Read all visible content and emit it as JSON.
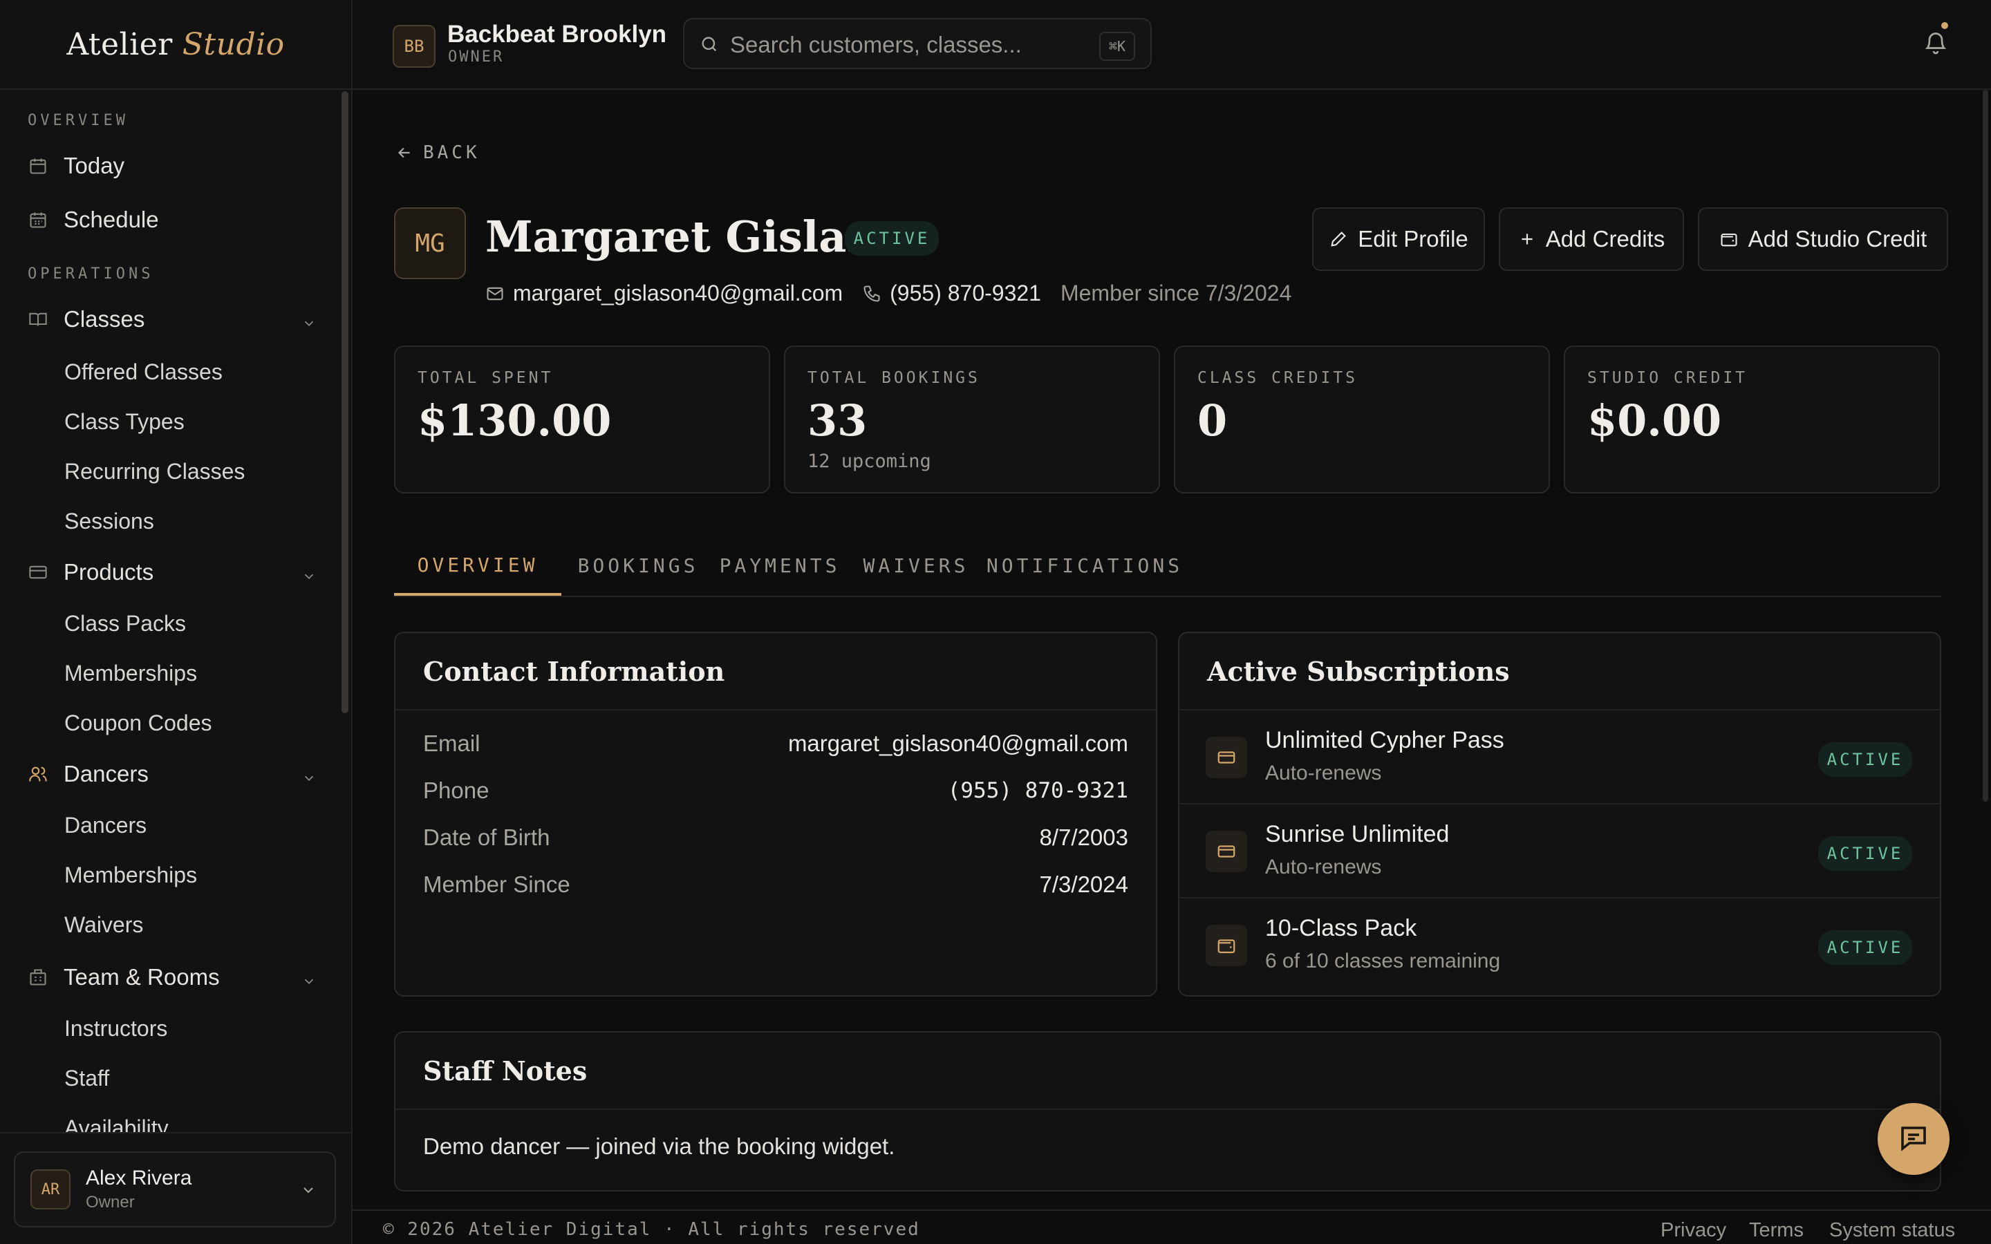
{
  "brand": {
    "part1": "Atelier",
    "part2": "Studio"
  },
  "sidebar": {
    "sections": [
      {
        "label": "OVERVIEW"
      },
      {
        "label": "OPERATIONS"
      }
    ],
    "items": [
      {
        "label": "Today",
        "icon": "calendar-icon"
      },
      {
        "label": "Schedule",
        "icon": "calendar-grid-icon"
      },
      {
        "label": "Classes",
        "icon": "book-icon"
      },
      {
        "label": "Products",
        "icon": "card-icon"
      },
      {
        "label": "Dancers",
        "icon": "users-icon"
      },
      {
        "label": "Team & Rooms",
        "icon": "building-icon"
      }
    ],
    "classes_sub": [
      "Offered Classes",
      "Class Types",
      "Recurring Classes",
      "Sessions"
    ],
    "products_sub": [
      "Class Packs",
      "Memberships",
      "Coupon Codes"
    ],
    "dancers_sub": [
      "Dancers",
      "Memberships",
      "Waivers"
    ],
    "team_sub": [
      "Instructors",
      "Staff",
      "Availability"
    ],
    "user": {
      "initials": "AR",
      "name": "Alex Rivera",
      "role": "Owner"
    }
  },
  "header": {
    "studio_initials": "BB",
    "studio_name": "Backbeat Brooklyn",
    "studio_role": "OWNER",
    "search_placeholder": "Search customers, classes...",
    "search_shortcut": "⌘K"
  },
  "customer": {
    "back_label": "BACK",
    "initials": "MG",
    "name": "Margaret Gislason",
    "status": "ACTIVE",
    "email": "margaret_gislason40@gmail.com",
    "phone": "(955) 870-9321",
    "member_since_text": "Member since 7/3/2024"
  },
  "actions": {
    "edit": "Edit Profile",
    "add_credits": "Add Credits",
    "add_studio_credit": "Add Studio Credit"
  },
  "stats": [
    {
      "label": "TOTAL SPENT",
      "value": "$130.00",
      "sub": ""
    },
    {
      "label": "TOTAL BOOKINGS",
      "value": "33",
      "sub": "12 upcoming"
    },
    {
      "label": "CLASS CREDITS",
      "value": "0",
      "sub": ""
    },
    {
      "label": "STUDIO CREDIT",
      "value": "$0.00",
      "sub": ""
    }
  ],
  "tabs": [
    {
      "label": "OVERVIEW",
      "active": true
    },
    {
      "label": "BOOKINGS"
    },
    {
      "label": "PAYMENTS"
    },
    {
      "label": "WAIVERS"
    },
    {
      "label": "NOTIFICATIONS"
    }
  ],
  "contact_card": {
    "title": "Contact Information",
    "rows": [
      {
        "key": "Email",
        "value": "margaret_gislason40@gmail.com"
      },
      {
        "key": "Phone",
        "value": "(955) 870-9321"
      },
      {
        "key": "Date of Birth",
        "value": "8/7/2003"
      },
      {
        "key": "Member Since",
        "value": "7/3/2024"
      }
    ]
  },
  "subscriptions_card": {
    "title": "Active Subscriptions",
    "items": [
      {
        "name": "Unlimited Cypher Pass",
        "desc": "Auto-renews",
        "status": "ACTIVE",
        "icon": "card-icon"
      },
      {
        "name": "Sunrise Unlimited",
        "desc": "Auto-renews",
        "status": "ACTIVE",
        "icon": "card-icon"
      },
      {
        "name": "10-Class Pack",
        "desc": "6 of 10 classes remaining",
        "status": "ACTIVE",
        "icon": "wallet-icon"
      }
    ]
  },
  "notes_card": {
    "title": "Staff Notes",
    "text": "Demo dancer — joined via the booking widget."
  },
  "footer": {
    "copyright": "© 2026 Atelier Digital · All rights reserved",
    "links": [
      "Privacy",
      "Terms",
      "System status"
    ]
  },
  "colors": {
    "accent": "#d4a66a",
    "success": "#6fc4a0",
    "bg": "#0d0d0e"
  }
}
